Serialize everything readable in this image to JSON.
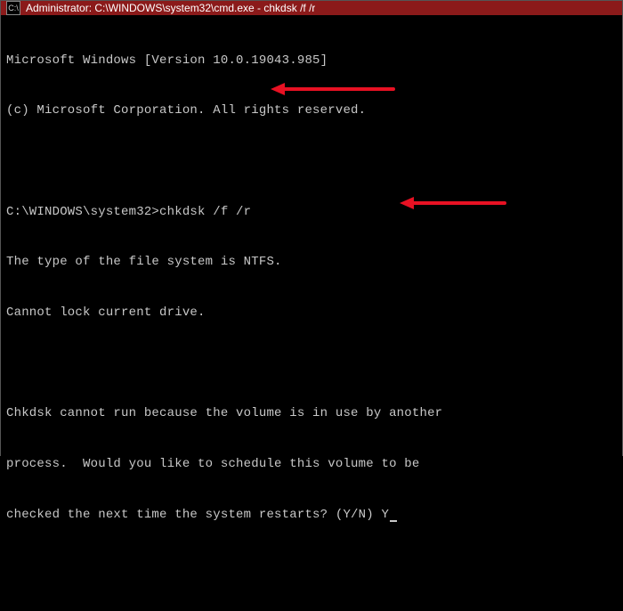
{
  "titlebar": {
    "icon_glyph": "C:\\",
    "title": "Administrator: C:\\WINDOWS\\system32\\cmd.exe - chkdsk  /f /r"
  },
  "terminal": {
    "banner1": "Microsoft Windows [Version 10.0.19043.985]",
    "banner2": "(c) Microsoft Corporation. All rights reserved.",
    "prompt1": "C:\\WINDOWS\\system32>",
    "command1": "chkdsk /f /r",
    "out1": "The type of the file system is NTFS.",
    "out2": "Cannot lock current drive.",
    "out3": "Chkdsk cannot run because the volume is in use by another",
    "out4": "process.  Would you like to schedule this volume to be",
    "out5": "checked the next time the system restarts? (Y/N) ",
    "answer": "Y"
  },
  "annotations": {
    "arrow1_target": "command-input",
    "arrow2_target": "confirmation-answer"
  },
  "colors": {
    "titlebar_bg": "#8b1a1a",
    "terminal_bg": "#000000",
    "terminal_fg": "#c8c8c8",
    "arrow": "#e81123"
  }
}
